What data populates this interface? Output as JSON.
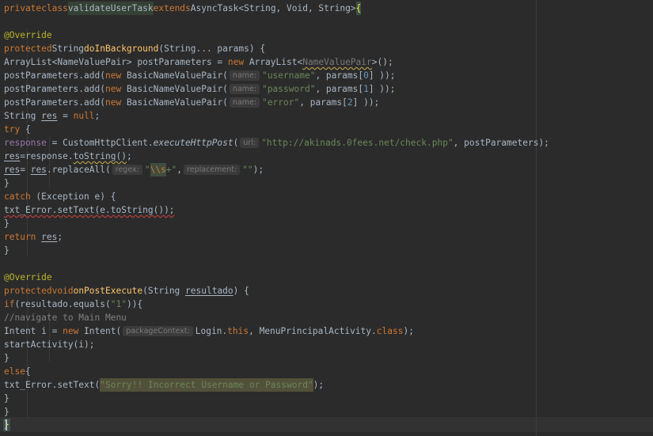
{
  "code": {
    "l1": {
      "k1": "private",
      "k2": "class",
      "name": "validateUserTask",
      "k3": "extends",
      "base": "AsyncTask<String, Void, String>",
      "brace": "{"
    },
    "l3": {
      "ann": "@Override"
    },
    "l4": {
      "k1": "protected",
      "t": "String",
      "m": "doInBackground",
      "rest": "(String... params) {"
    },
    "l5": {
      "a": "ArrayList<NameValuePair> postParameters = ",
      "k": "new",
      "b": " ArrayList<",
      "w": "NameValuePair",
      "c": ">();"
    },
    "l6": {
      "a": "postParameters.add(",
      "k": "new",
      "b": " BasicNameValuePair(",
      "hint": "name:",
      "s": "\"username\"",
      "c": ", params[",
      "n": "0",
      "d": "] ));"
    },
    "l7": {
      "a": "postParameters.add(",
      "k": "new",
      "b": " BasicNameValuePair(",
      "hint": "name:",
      "s": "\"password\"",
      "c": ", params[",
      "n": "1",
      "d": "] ));"
    },
    "l8": {
      "a": "postParameters.add(",
      "k": "new",
      "b": " BasicNameValuePair(",
      "hint": "name:",
      "s": "\"error\"",
      "c": ", params[",
      "n": "2",
      "d": "] ));"
    },
    "l9": {
      "a": "String ",
      "v": "res",
      "b": " = ",
      "k": "null",
      "c": ";"
    },
    "l10": {
      "k": "try",
      "b": " {"
    },
    "l11": {
      "f": "response",
      "a": " = CustomHttpClient.",
      "m": "executeHttpPost",
      "b": "(",
      "hint": "url:",
      "s": "\"http://akinads.0fees.net/check.php\"",
      "c": ", postParameters);"
    },
    "l12": {
      "v": "res",
      "a": "=response.",
      "w": "toString()",
      "c": ";"
    },
    "l13": {
      "v1": "res",
      "a": "= ",
      "v2": "res",
      "b": ".replaceAll(",
      "hint1": "regex:",
      "q1": "\"",
      "esc": "\\\\s",
      "q2": "+\"",
      "c": ",",
      "hint2": "replacement:",
      "s": "\"\"",
      "d": ");"
    },
    "l14": {
      "t": "}"
    },
    "l15": {
      "k": "catch",
      "b": " (Exception e) {"
    },
    "l16": {
      "e": "txt_Error.setText(e.toString());"
    },
    "l17": {
      "t": "}"
    },
    "l18": {
      "k": "return",
      "b": " ",
      "v": "res",
      "c": ";"
    },
    "l19": {
      "t": "}"
    },
    "l21": {
      "ann": "@Override"
    },
    "l22": {
      "k1": "protected",
      "k2": "void",
      "m": "onPostExecute",
      "a": "(String ",
      "v": "resultado",
      "b": ") {"
    },
    "l23": {
      "k": "if",
      "a": "(resultado.equals(",
      "s": "\"1\"",
      "b": ")){"
    },
    "l24": {
      "c": "//navigate to Main Menu"
    },
    "l25": {
      "a": "Intent i = ",
      "k": "new",
      "b": " Intent(",
      "hint": "packageContext:",
      "c": "Login.",
      "k2": "this",
      "d": ", MenuPrincipalActivity.",
      "k3": "class",
      "e": ");"
    },
    "l26": {
      "t": "startActivity(i);"
    },
    "l27": {
      "t": "}"
    },
    "l28": {
      "k": "else",
      "b": "{"
    },
    "l29": {
      "a": "txt_Error.setText(",
      "s": "\"Sorry!! Incorrect Username or Password\"",
      "b": ");"
    },
    "l30": {
      "t": "}"
    },
    "l31": {
      "t": "}"
    },
    "l32": {
      "t": "}"
    }
  }
}
